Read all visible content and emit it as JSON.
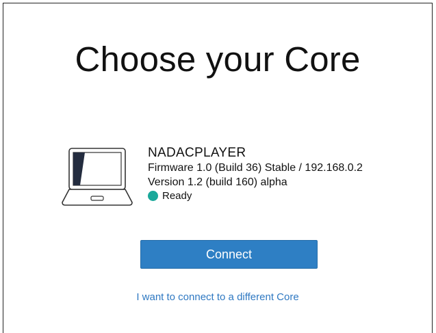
{
  "page": {
    "title": "Choose your Core"
  },
  "core": {
    "icon": "laptop-icon",
    "name": "NADACPLAYER",
    "firmware": "Firmware 1.0 (Build 36) Stable / 192.168.0.2",
    "version": "Version 1.2 (build 160) alpha",
    "status": {
      "text": "Ready",
      "color": "#1aa89a"
    }
  },
  "actions": {
    "connect_label": "Connect",
    "connect_color": "#2e7fc4",
    "alt_link_label": "I want to connect to a different Core",
    "alt_link_color": "#2e78c2"
  }
}
